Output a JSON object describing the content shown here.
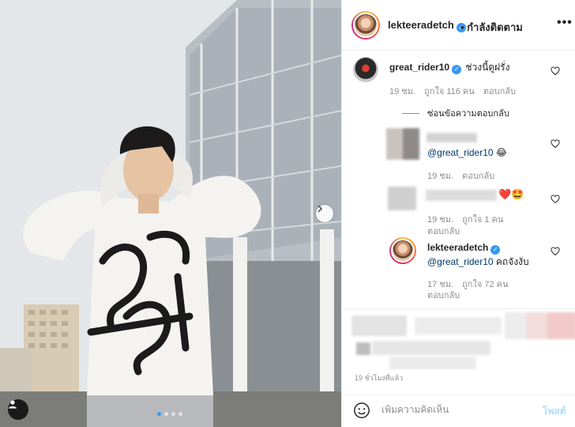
{
  "post": {
    "author": "lekteeradetch",
    "follow_status": "กำลังติดตาม",
    "more": "•••",
    "time_ago": "19 ชั่วโมงที่แล้ว",
    "carousel_pages": 4,
    "carousel_active": 1
  },
  "comments": [
    {
      "user": "great_rider10",
      "text": "ช่วงนี้ดูฝรั่ง",
      "time": "19 ชม.",
      "likes": "ถูกใจ 116 คน",
      "reply": "ตอบกลับ",
      "hide_replies": "ซ่อนข้อความตอบกลับ"
    }
  ],
  "replies": [
    {
      "mention": "@great_rider10",
      "emoji": "😂",
      "time": "19 ชม.",
      "reply": "ตอบกลับ"
    },
    {
      "emoji": "❤️🤩",
      "time": "19 ชม.",
      "likes": "ถูกใจ 1 คน",
      "reply": "ตอบกลับ"
    },
    {
      "user": "lekteeradetch",
      "mention": "@great_rider10",
      "text": "คถจังงับ",
      "time": "17 ชม.",
      "likes": "ถูกใจ 72 คน",
      "reply": "ตอบกลับ"
    }
  ],
  "composer": {
    "placeholder": "เพิ่มความคิดเห็น",
    "post_label": "โพสต์"
  },
  "colors": {
    "link_blue": "#3897f0",
    "post_disabled": "#b2dffc",
    "meta_gray": "#8e8e8e",
    "text": "#262626"
  },
  "icons": {
    "emoji": "smiley-icon",
    "heart": "heart-outline-icon",
    "verified": "verified-badge-icon",
    "next": "chevron-right-icon"
  }
}
